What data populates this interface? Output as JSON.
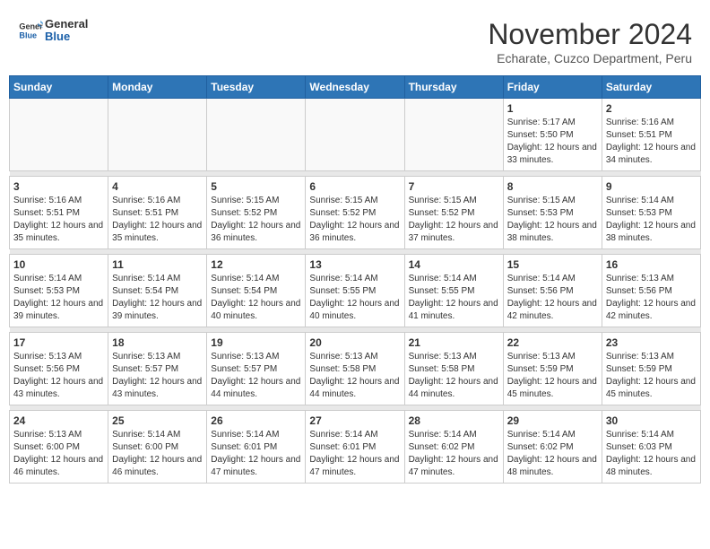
{
  "header": {
    "logo_line1": "General",
    "logo_line2": "Blue",
    "month": "November 2024",
    "location": "Echarate, Cuzco Department, Peru"
  },
  "weekdays": [
    "Sunday",
    "Monday",
    "Tuesday",
    "Wednesday",
    "Thursday",
    "Friday",
    "Saturday"
  ],
  "weeks": [
    [
      {
        "day": "",
        "info": ""
      },
      {
        "day": "",
        "info": ""
      },
      {
        "day": "",
        "info": ""
      },
      {
        "day": "",
        "info": ""
      },
      {
        "day": "",
        "info": ""
      },
      {
        "day": "1",
        "info": "Sunrise: 5:17 AM\nSunset: 5:50 PM\nDaylight: 12 hours and 33 minutes."
      },
      {
        "day": "2",
        "info": "Sunrise: 5:16 AM\nSunset: 5:51 PM\nDaylight: 12 hours and 34 minutes."
      }
    ],
    [
      {
        "day": "3",
        "info": "Sunrise: 5:16 AM\nSunset: 5:51 PM\nDaylight: 12 hours and 35 minutes."
      },
      {
        "day": "4",
        "info": "Sunrise: 5:16 AM\nSunset: 5:51 PM\nDaylight: 12 hours and 35 minutes."
      },
      {
        "day": "5",
        "info": "Sunrise: 5:15 AM\nSunset: 5:52 PM\nDaylight: 12 hours and 36 minutes."
      },
      {
        "day": "6",
        "info": "Sunrise: 5:15 AM\nSunset: 5:52 PM\nDaylight: 12 hours and 36 minutes."
      },
      {
        "day": "7",
        "info": "Sunrise: 5:15 AM\nSunset: 5:52 PM\nDaylight: 12 hours and 37 minutes."
      },
      {
        "day": "8",
        "info": "Sunrise: 5:15 AM\nSunset: 5:53 PM\nDaylight: 12 hours and 38 minutes."
      },
      {
        "day": "9",
        "info": "Sunrise: 5:14 AM\nSunset: 5:53 PM\nDaylight: 12 hours and 38 minutes."
      }
    ],
    [
      {
        "day": "10",
        "info": "Sunrise: 5:14 AM\nSunset: 5:53 PM\nDaylight: 12 hours and 39 minutes."
      },
      {
        "day": "11",
        "info": "Sunrise: 5:14 AM\nSunset: 5:54 PM\nDaylight: 12 hours and 39 minutes."
      },
      {
        "day": "12",
        "info": "Sunrise: 5:14 AM\nSunset: 5:54 PM\nDaylight: 12 hours and 40 minutes."
      },
      {
        "day": "13",
        "info": "Sunrise: 5:14 AM\nSunset: 5:55 PM\nDaylight: 12 hours and 40 minutes."
      },
      {
        "day": "14",
        "info": "Sunrise: 5:14 AM\nSunset: 5:55 PM\nDaylight: 12 hours and 41 minutes."
      },
      {
        "day": "15",
        "info": "Sunrise: 5:14 AM\nSunset: 5:56 PM\nDaylight: 12 hours and 42 minutes."
      },
      {
        "day": "16",
        "info": "Sunrise: 5:13 AM\nSunset: 5:56 PM\nDaylight: 12 hours and 42 minutes."
      }
    ],
    [
      {
        "day": "17",
        "info": "Sunrise: 5:13 AM\nSunset: 5:56 PM\nDaylight: 12 hours and 43 minutes."
      },
      {
        "day": "18",
        "info": "Sunrise: 5:13 AM\nSunset: 5:57 PM\nDaylight: 12 hours and 43 minutes."
      },
      {
        "day": "19",
        "info": "Sunrise: 5:13 AM\nSunset: 5:57 PM\nDaylight: 12 hours and 44 minutes."
      },
      {
        "day": "20",
        "info": "Sunrise: 5:13 AM\nSunset: 5:58 PM\nDaylight: 12 hours and 44 minutes."
      },
      {
        "day": "21",
        "info": "Sunrise: 5:13 AM\nSunset: 5:58 PM\nDaylight: 12 hours and 44 minutes."
      },
      {
        "day": "22",
        "info": "Sunrise: 5:13 AM\nSunset: 5:59 PM\nDaylight: 12 hours and 45 minutes."
      },
      {
        "day": "23",
        "info": "Sunrise: 5:13 AM\nSunset: 5:59 PM\nDaylight: 12 hours and 45 minutes."
      }
    ],
    [
      {
        "day": "24",
        "info": "Sunrise: 5:13 AM\nSunset: 6:00 PM\nDaylight: 12 hours and 46 minutes."
      },
      {
        "day": "25",
        "info": "Sunrise: 5:14 AM\nSunset: 6:00 PM\nDaylight: 12 hours and 46 minutes."
      },
      {
        "day": "26",
        "info": "Sunrise: 5:14 AM\nSunset: 6:01 PM\nDaylight: 12 hours and 47 minutes."
      },
      {
        "day": "27",
        "info": "Sunrise: 5:14 AM\nSunset: 6:01 PM\nDaylight: 12 hours and 47 minutes."
      },
      {
        "day": "28",
        "info": "Sunrise: 5:14 AM\nSunset: 6:02 PM\nDaylight: 12 hours and 47 minutes."
      },
      {
        "day": "29",
        "info": "Sunrise: 5:14 AM\nSunset: 6:02 PM\nDaylight: 12 hours and 48 minutes."
      },
      {
        "day": "30",
        "info": "Sunrise: 5:14 AM\nSunset: 6:03 PM\nDaylight: 12 hours and 48 minutes."
      }
    ]
  ]
}
